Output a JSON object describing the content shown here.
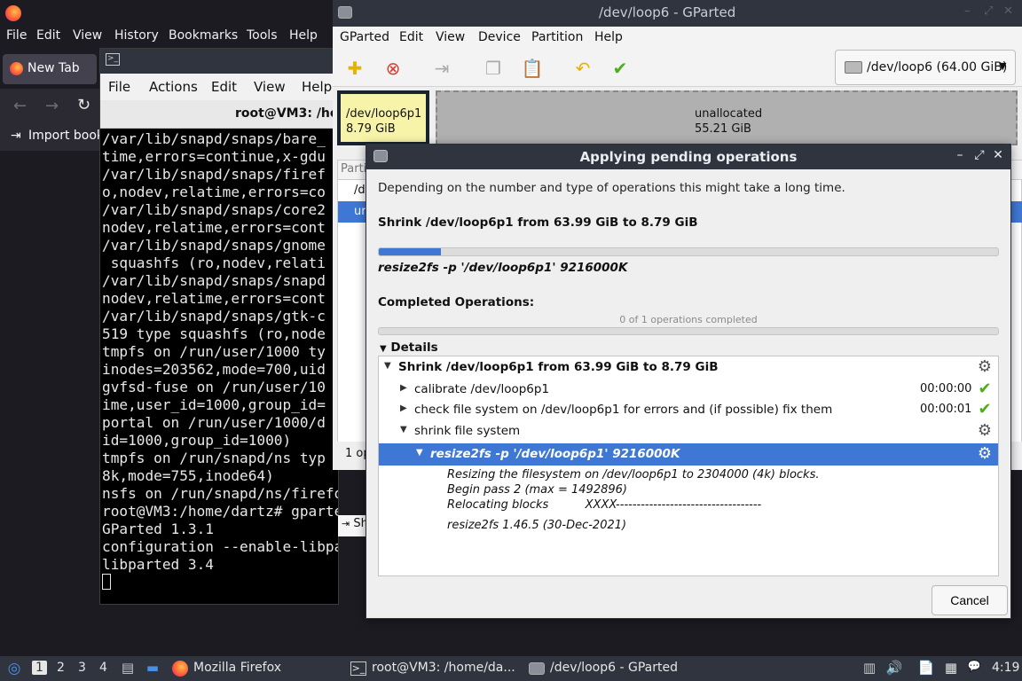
{
  "firefox": {
    "menu": [
      "File",
      "Edit",
      "View",
      "History",
      "Bookmarks",
      "Tools",
      "Help"
    ],
    "tab_label": "New Tab",
    "bookmarks_label": "Import bookm"
  },
  "terminal": {
    "menu": [
      "File",
      "Actions",
      "Edit",
      "View",
      "Help"
    ],
    "title": "root@VM3: /ho",
    "lines": [
      "/var/lib/snapd/snaps/bare_",
      "time,errors=continue,x-gdu",
      "/var/lib/snapd/snaps/firef",
      "o,nodev,relatime,errors=co",
      "/var/lib/snapd/snaps/core2",
      "nodev,relatime,errors=cont",
      "/var/lib/snapd/snaps/gnome",
      " squashfs (ro,nodev,relati",
      "/var/lib/snapd/snaps/snapd",
      "nodev,relatime,errors=cont",
      "/var/lib/snapd/snaps/gtk-c",
      "519 type squashfs (ro,node",
      "tmpfs on /run/user/1000 ty",
      "inodes=203562,mode=700,uid",
      "gvfsd-fuse on /run/user/10",
      "ime,user_id=1000,group_id=",
      "portal on /run/user/1000/d",
      "id=1000,group_id=1000)",
      "tmpfs on /run/snapd/ns typ",
      "8k,mode=755,inode64)",
      "nsfs on /run/snapd/ns/firefox.",
      "root@VM3:/home/dartz# gparted",
      "GParted 1.3.1",
      "configuration --enable-libpart",
      "libparted 3.4"
    ]
  },
  "gparted": {
    "title": "/dev/loop6 - GParted",
    "menu": [
      "GParted",
      "Edit",
      "View",
      "Device",
      "Partition",
      "Help"
    ],
    "device": "/dev/loop6 (64.00 GiB)",
    "partition1": {
      "name": "/dev/loop6p1",
      "size": "8.79 GiB"
    },
    "unallocated": {
      "name": "unallocated",
      "size": "55.21 GiB"
    },
    "list_header": "Parti",
    "list_row1": "/d",
    "list_row2": "ur",
    "pending_label": "Sh",
    "status": "1 op"
  },
  "dialog": {
    "title": "Applying pending operations",
    "description": "Depending on the number and type of operations this might take a long time.",
    "operation": "Shrink /dev/loop6p1 from 63.99 GiB to 8.79 GiB",
    "progress": 0.1,
    "command": "resize2fs -p '/dev/loop6p1' 9216000K",
    "completed_label": "Completed Operations:",
    "completed_count": "0 of 1 operations completed",
    "completed_progress": 0,
    "details_label": "Details",
    "tree": {
      "root": "Shrink /dev/loop6p1 from 63.99 GiB to 8.79 GiB",
      "step1": {
        "label": "calibrate /dev/loop6p1",
        "time": "00:00:00"
      },
      "step2": {
        "label": "check file system on /dev/loop6p1 for errors and (if possible) fix them",
        "time": "00:00:01"
      },
      "step3": {
        "label": "shrink file system"
      },
      "step3a": {
        "label": "resize2fs -p '/dev/loop6p1' 9216000K"
      },
      "output": [
        "Resizing the filesystem on /dev/loop6p1 to 2304000 (4k) blocks.",
        "Begin pass 2 (max = 1492896)",
        "Relocating blocks          XXXX-----------------------------------",
        "resize2fs 1.46.5 (30-Dec-2021)"
      ]
    },
    "cancel_label": "Cancel"
  },
  "taskbar": {
    "workspaces": [
      "1",
      "2",
      "3",
      "4"
    ],
    "tasks": [
      "Mozilla Firefox",
      "root@VM3: /home/da...",
      "/dev/loop6 - GParted"
    ],
    "clock": "4:19"
  }
}
